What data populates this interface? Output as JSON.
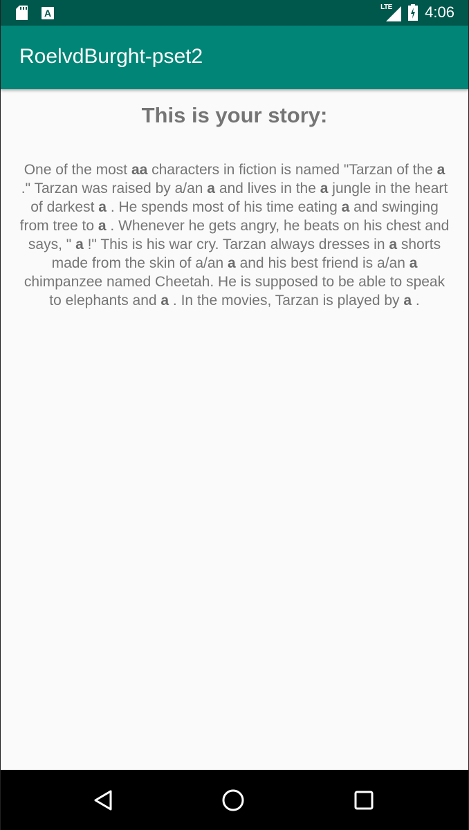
{
  "status_bar": {
    "time": "4:06",
    "network": "LTE",
    "icons": [
      "sd-card-icon",
      "a-notification-icon",
      "signal-icon",
      "battery-charging-icon"
    ]
  },
  "app_bar": {
    "title": "RoelvdBurght-pset2",
    "color": "#008577",
    "status_color": "#00574b"
  },
  "story": {
    "heading": "This is your story:",
    "segments": [
      {
        "text": "One of the most ",
        "bold": false
      },
      {
        "text": "aa",
        "bold": true
      },
      {
        "text": " characters in fiction is named \"Tarzan of the ",
        "bold": false
      },
      {
        "text": "a",
        "bold": true
      },
      {
        "text": " .\" Tarzan was raised by a/an ",
        "bold": false
      },
      {
        "text": "a",
        "bold": true
      },
      {
        "text": " and lives in the ",
        "bold": false
      },
      {
        "text": "a",
        "bold": true
      },
      {
        "text": " jungle in the heart of darkest ",
        "bold": false
      },
      {
        "text": "a",
        "bold": true
      },
      {
        "text": " . He spends most of his time eating ",
        "bold": false
      },
      {
        "text": "a",
        "bold": true
      },
      {
        "text": " and swinging from tree to ",
        "bold": false
      },
      {
        "text": "a",
        "bold": true
      },
      {
        "text": " . Whenever he gets angry, he beats on his chest and says, \" ",
        "bold": false
      },
      {
        "text": "a",
        "bold": true
      },
      {
        "text": " !\" This is his war cry. Tarzan always dresses in ",
        "bold": false
      },
      {
        "text": "a",
        "bold": true
      },
      {
        "text": " shorts made from the skin of a/an ",
        "bold": false
      },
      {
        "text": "a",
        "bold": true
      },
      {
        "text": " and his best friend is a/an ",
        "bold": false
      },
      {
        "text": "a",
        "bold": true
      },
      {
        "text": " chimpanzee named Cheetah. He is supposed to be able to speak to elephants and ",
        "bold": false
      },
      {
        "text": "a",
        "bold": true
      },
      {
        "text": " . In the movies, Tarzan is played by ",
        "bold": false
      },
      {
        "text": "a",
        "bold": true
      },
      {
        "text": " .",
        "bold": false
      }
    ]
  },
  "nav_bar": {
    "buttons": [
      "back-icon",
      "home-icon",
      "recents-icon"
    ]
  }
}
